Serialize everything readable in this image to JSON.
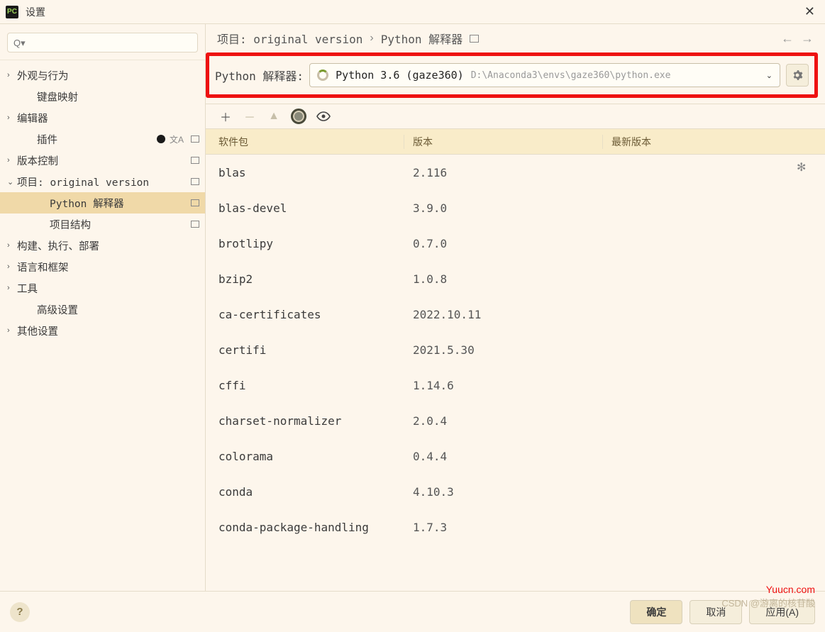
{
  "window": {
    "title": "设置"
  },
  "sidebar": {
    "search_placeholder": "Q▾",
    "items": [
      {
        "label": "外观与行为",
        "expandable": true,
        "level": 0
      },
      {
        "label": "键盘映射",
        "expandable": false,
        "level": 1
      },
      {
        "label": "编辑器",
        "expandable": true,
        "level": 0
      },
      {
        "label": "插件",
        "expandable": false,
        "level": 1,
        "has_dot": true,
        "has_lang": true,
        "has_proj": true
      },
      {
        "label": "版本控制",
        "expandable": true,
        "level": 0,
        "has_proj": true
      },
      {
        "label": "项目: original version",
        "expandable": true,
        "level": 0,
        "expanded": true,
        "has_proj": true,
        "mono": true
      },
      {
        "label": "Python 解释器",
        "expandable": false,
        "level": 2,
        "selected": true,
        "has_proj": true,
        "mono": true
      },
      {
        "label": "项目结构",
        "expandable": false,
        "level": 2,
        "has_proj": true
      },
      {
        "label": "构建、执行、部署",
        "expandable": true,
        "level": 0
      },
      {
        "label": "语言和框架",
        "expandable": true,
        "level": 0
      },
      {
        "label": "工具",
        "expandable": true,
        "level": 0
      },
      {
        "label": "高级设置",
        "expandable": false,
        "level": 1
      },
      {
        "label": "其他设置",
        "expandable": true,
        "level": 0
      }
    ]
  },
  "breadcrumb": {
    "part1": "项目: original version",
    "sep": "›",
    "part2": "Python 解释器"
  },
  "interpreter": {
    "label": "Python 解释器:",
    "name": "Python 3.6 (gaze360)",
    "path": "D:\\Anaconda3\\envs\\gaze360\\python.exe"
  },
  "table": {
    "headers": {
      "name": "软件包",
      "version": "版本",
      "latest": "最新版本"
    },
    "rows": [
      {
        "name": "blas",
        "version": "2.116"
      },
      {
        "name": "blas-devel",
        "version": "3.9.0"
      },
      {
        "name": "brotlipy",
        "version": "0.7.0"
      },
      {
        "name": "bzip2",
        "version": "1.0.8"
      },
      {
        "name": "ca-certificates",
        "version": "2022.10.11"
      },
      {
        "name": "certifi",
        "version": "2021.5.30"
      },
      {
        "name": "cffi",
        "version": "1.14.6"
      },
      {
        "name": "charset-normalizer",
        "version": "2.0.4"
      },
      {
        "name": "colorama",
        "version": "0.4.4"
      },
      {
        "name": "conda",
        "version": "4.10.3"
      },
      {
        "name": "conda-package-handling",
        "version": "1.7.3"
      }
    ]
  },
  "buttons": {
    "ok": "确定",
    "cancel": "取消",
    "apply": "应用(A)"
  },
  "watermarks": {
    "csdn": "CSDN @游离的核苷酸",
    "yuucn": "Yuucn.com"
  }
}
